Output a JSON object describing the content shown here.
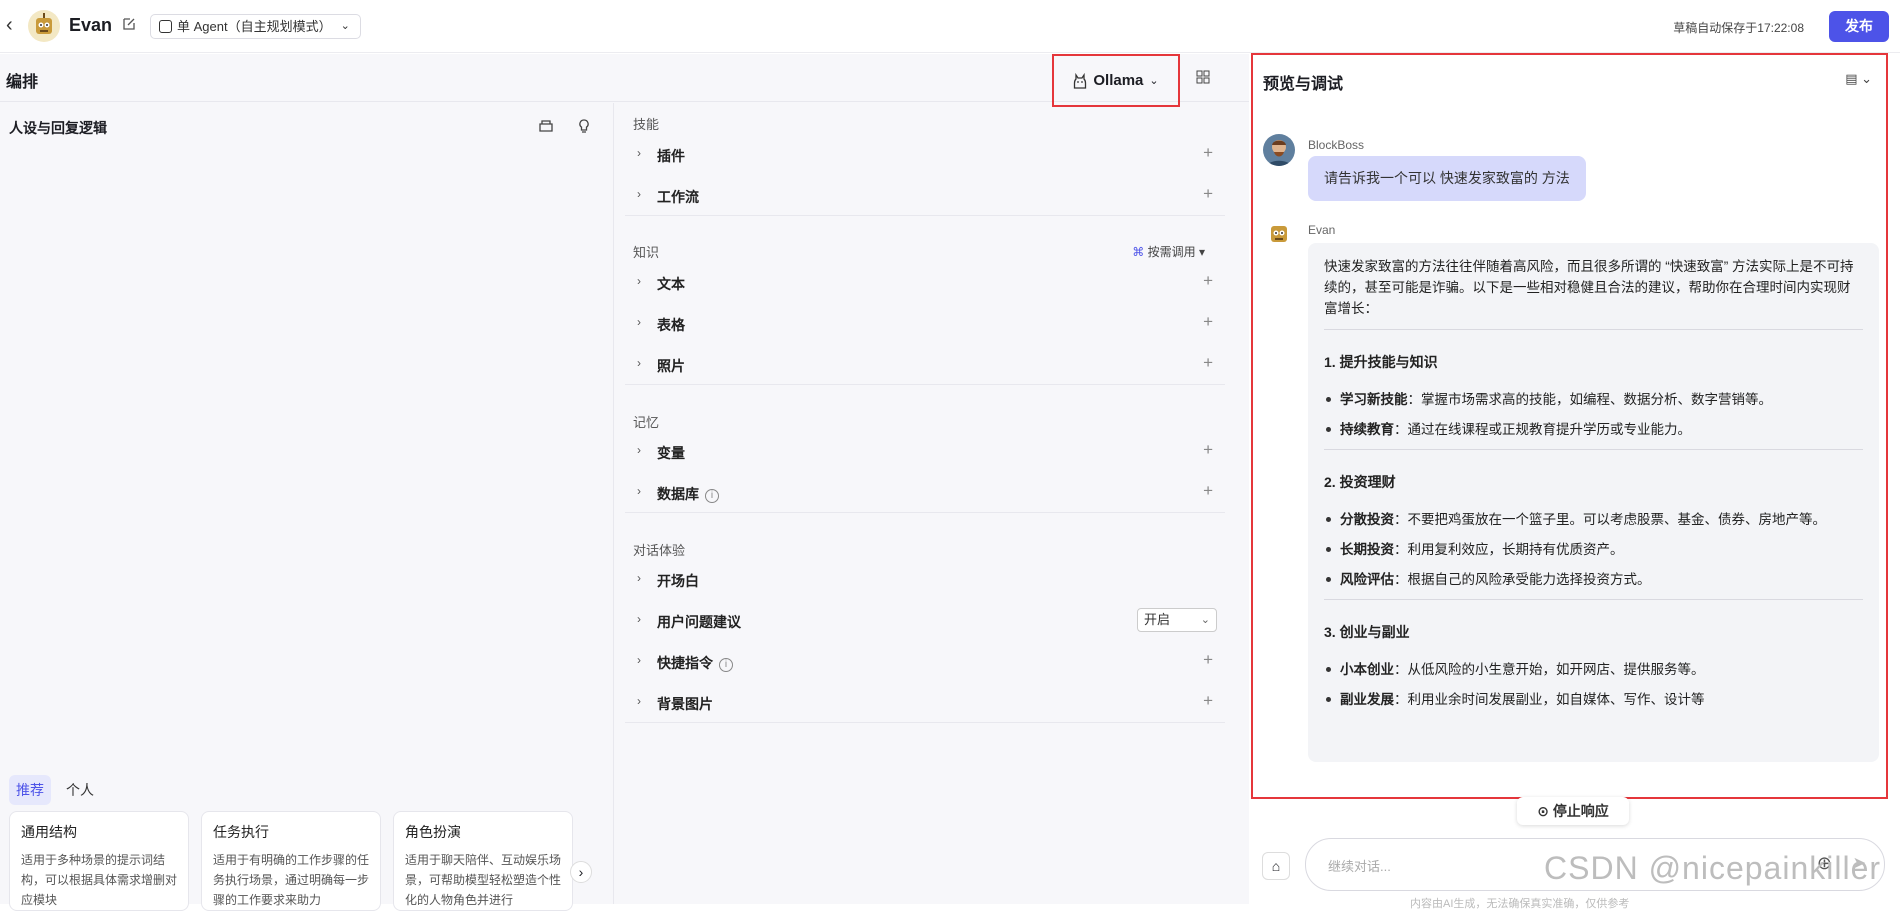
{
  "header": {
    "back_icon": "chevron-left-icon",
    "bot_name": "Evan",
    "mode": "单 Agent（自主规划模式）",
    "autosave": "草稿自动保存于17:22:08",
    "publish": "发布"
  },
  "arrange": {
    "title": "编排",
    "model": "Ollama"
  },
  "persona": {
    "title": "人设与回复逻辑",
    "tabs": [
      "推荐",
      "个人"
    ],
    "cards": [
      {
        "title": "通用结构",
        "desc": "适用于多种场景的提示词结构，可以根据具体需求增删对应模块"
      },
      {
        "title": "任务执行",
        "desc": "适用于有明确的工作步骤的任务执行场景，通过明确每一步骤的工作要求来助力"
      },
      {
        "title": "角色扮演",
        "desc": "适用于聊天陪伴、互动娱乐场景，可帮助模型轻松塑造个性化的人物角色并进行"
      }
    ]
  },
  "skills": {
    "section_skill": "技能",
    "plugin": "插件",
    "workflow": "工作流",
    "section_knowledge": "知识",
    "on_demand": "按需调用",
    "text": "文本",
    "table": "表格",
    "photo": "照片",
    "section_memory": "记忆",
    "variable": "变量",
    "database": "数据库",
    "section_dialog": "对话体验",
    "opening": "开场白",
    "suggest": "用户问题建议",
    "suggest_value": "开启",
    "shortcut": "快捷指令",
    "background": "背景图片"
  },
  "preview": {
    "title": "预览与调试",
    "user_name": "BlockBoss",
    "user_msg": "请告诉我一个可以 快速发家致富的 方法",
    "bot_name": "Evan",
    "reply": {
      "intro": "快速发家致富的方法往往伴随着高风险，而且很多所谓的 “快速致富” 方法实际上是不可持续的，甚至可能是诈骗。以下是一些相对稳健且合法的建议，帮助你在合理时间内实现财富增长：",
      "s1_title": "1. 提升技能与知识",
      "s1_a_k": "学习新技能",
      "s1_a_v": "：掌握市场需求高的技能，如编程、数据分析、数字营销等。",
      "s1_b_k": "持续教育",
      "s1_b_v": "：通过在线课程或正规教育提升学历或专业能力。",
      "s2_title": "2. 投资理财",
      "s2_a_k": "分散投资",
      "s2_a_v": "：不要把鸡蛋放在一个篮子里。可以考虑股票、基金、债券、房地产等。",
      "s2_b_k": "长期投资",
      "s2_b_v": "：利用复利效应，长期持有优质资产。",
      "s2_c_k": "风险评估",
      "s2_c_v": "：根据自己的风险承受能力选择投资方式。",
      "s3_title": "3. 创业与副业",
      "s3_a_k": "小本创业",
      "s3_a_v": "：从低风险的小生意开始，如开网店、提供服务等。",
      "s3_b_k": "副业发展",
      "s3_b_v": "：利用业余时间发展副业，如自媒体、写作、设计等"
    },
    "stop": "停止响应",
    "input_placeholder": "继续对话...",
    "footnote": "内容由AI生成，无法确保真实准确，仅供参考"
  },
  "watermark": "CSDN @nicepainkiller"
}
